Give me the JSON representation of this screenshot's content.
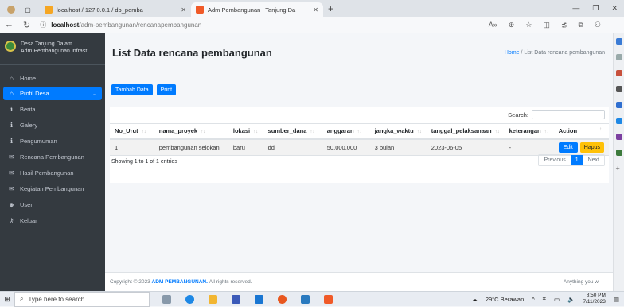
{
  "browser": {
    "tabs": [
      {
        "title": "localhost / 127.0.0.1 / db_pemba",
        "active": false
      },
      {
        "title": "Adm Pembangunan | Tanjung Da",
        "active": true
      }
    ],
    "url_host": "localhost",
    "url_path": "/adm-pembangunan/rencanapembangunan"
  },
  "sidebar": {
    "brand_line1": "Desa Tanjung Dalam",
    "brand_line2": "Adm Pembangunan Infrast",
    "items": [
      {
        "label": "Home"
      },
      {
        "label": "Profil Desa"
      },
      {
        "label": "Berita"
      },
      {
        "label": "Galery"
      },
      {
        "label": "Pengumuman"
      },
      {
        "label": "Rencana Pembangunan"
      },
      {
        "label": "Hasil Pembangunan"
      },
      {
        "label": "Kegiatan Pembangunan"
      },
      {
        "label": "User"
      },
      {
        "label": "Keluar"
      }
    ]
  },
  "main": {
    "title": "List Data rencana pembangunan",
    "breadcrumb_home": "Home",
    "breadcrumb_sep": "/",
    "breadcrumb_current": "List Data rencana pembangunan",
    "btn_add": "Tambah Data",
    "btn_print": "Print",
    "search_label": "Search:",
    "columns": [
      "No_Urut",
      "nama_proyek",
      "lokasi",
      "sumber_dana",
      "anggaran",
      "jangka_waktu",
      "tanggal_pelaksanaan",
      "keterangan",
      "Action"
    ],
    "rows": [
      {
        "no": "1",
        "nama": "pembangunan selokan",
        "lokasi": "baru",
        "sumber": "dd",
        "anggaran": "50.000.000",
        "jangka": "3 bulan",
        "tanggal": "2023-06-05",
        "ket": "-"
      }
    ],
    "btn_edit": "Edit",
    "btn_hapus": "Hapus",
    "info": "Showing 1 to 1 of 1 entries",
    "pager_prev": "Previous",
    "pager_page": "1",
    "pager_next": "Next"
  },
  "footer": {
    "copyright": "Copyright © 2023",
    "brand": "ADM PEMBANGUNAN.",
    "rights": "All rights reserved.",
    "right_text": "Anything you w"
  },
  "taskbar": {
    "search_placeholder": "Type here to search",
    "weather": "29°C Berawan",
    "time": "8:50 PM",
    "date": "7/11/2023"
  }
}
